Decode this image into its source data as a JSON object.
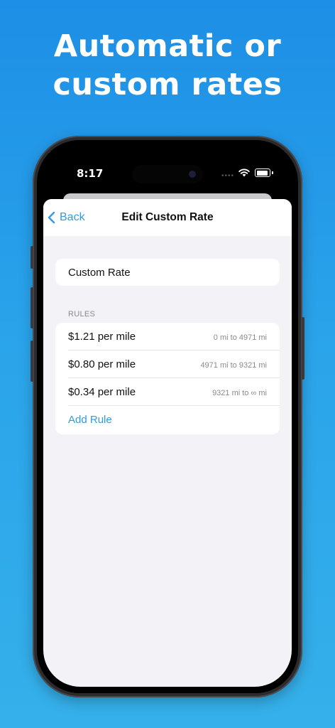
{
  "headline": {
    "line1": "Automatic or",
    "line2": "custom rates"
  },
  "status_bar": {
    "time": "8:17",
    "icons": [
      "dynamic-island",
      "wifi-icon",
      "battery-icon"
    ]
  },
  "nav": {
    "back_label": "Back",
    "title": "Edit Custom Rate"
  },
  "rate_name": {
    "value": "Custom Rate"
  },
  "rules_section": {
    "header": "RULES",
    "rules": [
      {
        "rate": "$1.21 per mile",
        "range": "0 mi to 4971 mi"
      },
      {
        "rate": "$0.80 per mile",
        "range": "4971 mi to 9321 mi"
      },
      {
        "rate": "$0.34 per mile",
        "range": "9321 mi to ∞ mi"
      }
    ],
    "add_label": "Add Rule"
  },
  "colors": {
    "accent": "#2f9be0",
    "background_top": "#1d8fe6",
    "background_bottom": "#35b0ea",
    "grouped_background": "#f2f2f7"
  }
}
